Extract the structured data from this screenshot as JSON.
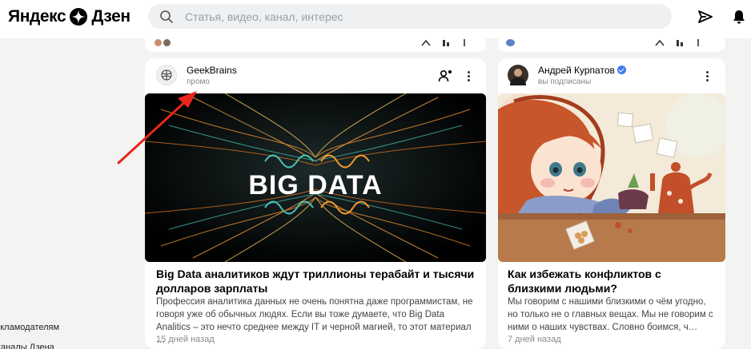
{
  "header": {
    "logo": "Яндекс",
    "logo_suffix": "Дзен",
    "search_placeholder": "Статья, видео, канал, интерес"
  },
  "sidebar": {
    "items": [
      "рекламодателям",
      "каналы Дзена"
    ]
  },
  "feed": {
    "cards": [
      {
        "author": "GeekBrains",
        "subtitle": "промо",
        "image_text": "BIG DATA",
        "title": "Big Data аналитиков ждут триллионы терабайт и тысячи долларов зарплаты",
        "description": "Профессия аналитика данных не очень понятна даже программистам, не говоря уже об обычных людях. Если вы тоже думаете, что Big Data Analitics – это нечто среднее между IT и черной магией, то этот материал …",
        "time": "15 дней назад"
      },
      {
        "author": "Андрей Курпатов",
        "subtitle": "вы подписаны",
        "title": "Как избежать конфликтов с близкими людьми?",
        "description": "Мы говорим с нашими близкими о чём угодно, но только не о главных вещах. Мы не говорим с ними о наших чувствах. Словно боимся, ч…",
        "time": "7 дней назад"
      }
    ]
  },
  "colors": {
    "background": "#f3f3f2",
    "accent_red": "#e8261b",
    "verified_blue": "#3d7bf5"
  }
}
